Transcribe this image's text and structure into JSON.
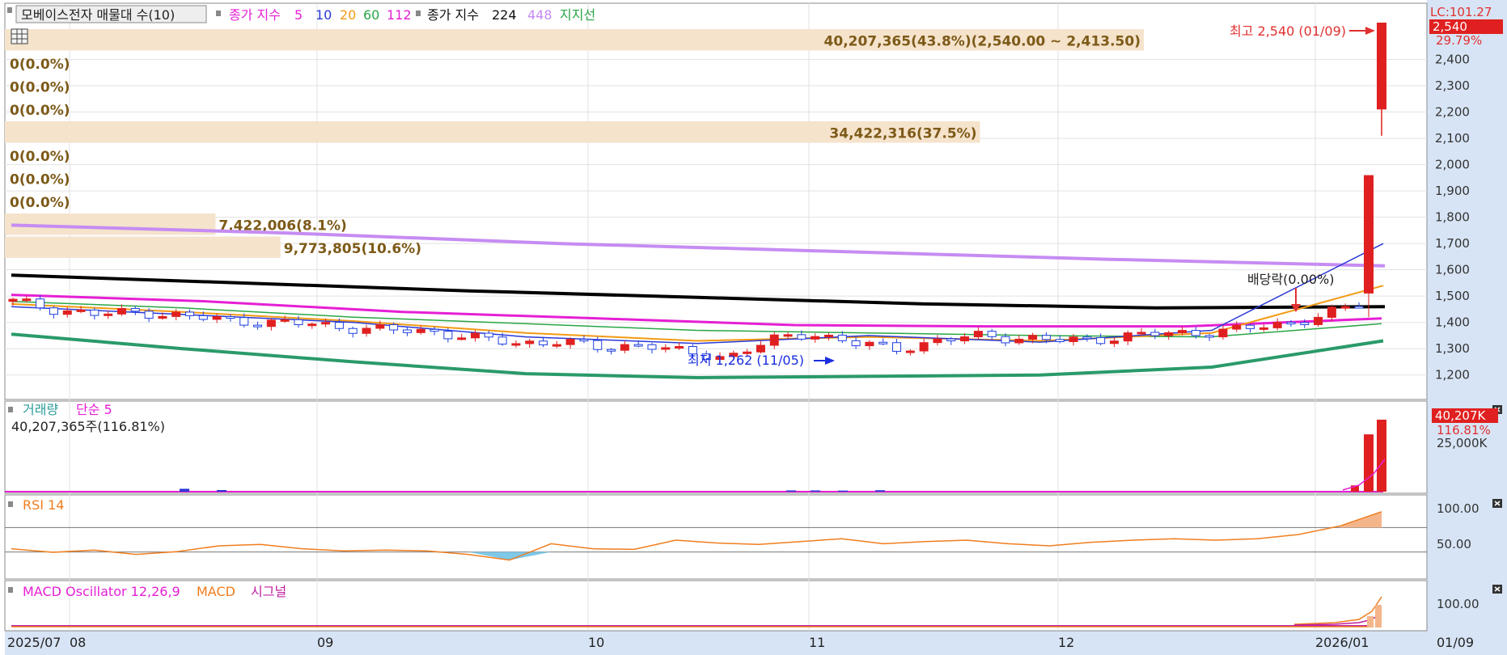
{
  "header": {
    "indicator_box": "모베이스전자 매물대 수(10)",
    "ma_group1_label": "종가 지수",
    "ma_periods_1": [
      {
        "period": "5",
        "color": "#e61fd4"
      },
      {
        "period": "10",
        "color": "#2a39d6"
      },
      {
        "period": "20",
        "color": "#f39a14"
      },
      {
        "period": "60",
        "color": "#2aa645"
      },
      {
        "period": "112",
        "color": "#e61fd4"
      }
    ],
    "ma_group2_label": "종가 지수",
    "ma_periods_2": [
      {
        "period": "224",
        "color": "#000000"
      },
      {
        "period": "448",
        "color": "#c68cf2"
      }
    ],
    "support_label": "지지선"
  },
  "right_axis": {
    "lc_label": "LC:101.27",
    "price_tag": "2,540",
    "pct_tag": "29.79%",
    "price_ticks": [
      "2,400",
      "2,300",
      "2,200",
      "2,100",
      "2,000",
      "1,900",
      "1,800",
      "1,700",
      "1,600",
      "1,500",
      "1,400",
      "1,300",
      "1,200"
    ],
    "volume_tag": "40,207K",
    "volume_pct_tag": "116.81%",
    "volume_tick": "25,000K",
    "rsi_ticks": [
      "100.00",
      "50.00"
    ],
    "macd_ticks": [
      "100.00"
    ]
  },
  "x_axis": {
    "labels": [
      "2025/07",
      "08",
      "09",
      "10",
      "11",
      "12",
      "2026/01"
    ],
    "right_label": "01/09"
  },
  "volume_profile_bars": [
    {
      "label": "40,207,365(43.8%)(2,540.00 ~ 2,413.50)"
    },
    {
      "label": "0(0.0%)"
    },
    {
      "label": "0(0.0%)"
    },
    {
      "label": "0(0.0%)"
    },
    {
      "label": "34,422,316(37.5%)"
    },
    {
      "label": "0(0.0%)"
    },
    {
      "label": "0(0.0%)"
    },
    {
      "label": "0(0.0%)"
    },
    {
      "label": "7,422,006(8.1%)"
    },
    {
      "label": "9,773,805(10.6%)"
    }
  ],
  "annotations": {
    "high": "최고 2,540 (01/09)",
    "low": "최저 1,262 (11/05)",
    "dividend": "배당락(0.00%)"
  },
  "volume_panel": {
    "title": "거래량",
    "ma_label": "단순 5",
    "readout": "40,207,365주(116.81%)"
  },
  "rsi_panel": {
    "title": "RSI 14"
  },
  "macd_panel": {
    "title": "MACD Oscillator 12,26,9",
    "macd_label": "MACD",
    "signal_label": "시그널"
  },
  "chart_data": {
    "type": "candlestick",
    "price_range": [
      1150,
      2540
    ],
    "high": {
      "price": 2540,
      "date": "01/09"
    },
    "low": {
      "price": 1262,
      "date": "11/05"
    },
    "last_candle": {
      "open": 2210,
      "high": 2540,
      "low": 2110,
      "close": 2540
    },
    "volume_profile": [
      {
        "volume": 40207365,
        "pct": 43.8,
        "low": 2413.5,
        "high": 2540.0
      },
      {
        "volume": 0,
        "pct": 0.0
      },
      {
        "volume": 0,
        "pct": 0.0
      },
      {
        "volume": 0,
        "pct": 0.0
      },
      {
        "volume": 34422316,
        "pct": 37.5
      },
      {
        "volume": 0,
        "pct": 0.0
      },
      {
        "volume": 0,
        "pct": 0.0
      },
      {
        "volume": 0,
        "pct": 0.0
      },
      {
        "volume": 7422006,
        "pct": 8.1
      },
      {
        "volume": 9773805,
        "pct": 10.6
      }
    ],
    "ma_448": [
      1770,
      1740,
      1700,
      1670,
      1640,
      1615
    ],
    "ma_224": [
      1580,
      1550,
      1520,
      1495,
      1470,
      1455,
      1460
    ],
    "support": [
      1355,
      1300,
      1250,
      1205,
      1190,
      1195,
      1200,
      1230,
      1330
    ],
    "ma_112": [
      1505,
      1480,
      1440,
      1415,
      1390,
      1385,
      1385,
      1415
    ],
    "ma_60": [
      1480,
      1455,
      1420,
      1395,
      1370,
      1360,
      1350,
      1345,
      1395
    ],
    "ma_20": [
      1470,
      1440,
      1405,
      1360,
      1330,
      1345,
      1330,
      1360,
      1540
    ],
    "ma_10": [
      1460,
      1430,
      1400,
      1345,
      1320,
      1350,
      1325,
      1370,
      1700
    ],
    "volume_latest": 40207365,
    "volume_latest_pct": 116.81,
    "volume_prev": 32000000,
    "rsi_range": [
      0,
      100
    ],
    "rsi": [
      38,
      33,
      36,
      30,
      34,
      42,
      44,
      38,
      35,
      36,
      35,
      30,
      22,
      45,
      38,
      37,
      50,
      46,
      44,
      48,
      52,
      45,
      48,
      50,
      45,
      42,
      47,
      50,
      52,
      50,
      52,
      58,
      70,
      90
    ],
    "macd_latest": 130
  }
}
